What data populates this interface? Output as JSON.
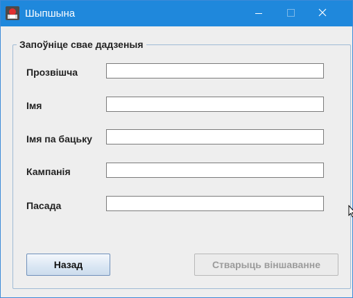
{
  "window": {
    "title": "Шыпшына",
    "icon": "app-icon",
    "controls": [
      "minimize-icon",
      "maximize-icon",
      "close-icon"
    ]
  },
  "form": {
    "legend": "Запоўніце свае дадзеныя",
    "fields": [
      {
        "label": "Прозвішча",
        "value": ""
      },
      {
        "label": "Імя",
        "value": ""
      },
      {
        "label": "Імя па бацьку",
        "value": ""
      },
      {
        "label": "Кампанія",
        "value": ""
      },
      {
        "label": "Пасада",
        "value": ""
      }
    ]
  },
  "buttons": {
    "back": "Назад",
    "create": "Стварыць віншаванне"
  },
  "colors": {
    "titlebar": "#1f88dc",
    "window_border": "#3c8ad8",
    "background": "#eeeeee",
    "disabled_text": "#9b9b9b"
  }
}
